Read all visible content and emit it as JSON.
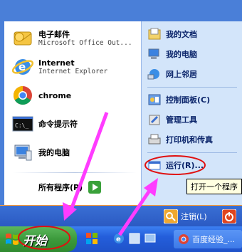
{
  "left_items": [
    {
      "title": "电子邮件",
      "sub": "Microsoft Office Out...",
      "icon": "outlook-mail-icon"
    },
    {
      "title": "Internet",
      "sub": "Internet Explorer",
      "icon": "internet-explorer-icon"
    },
    {
      "title": "chrome",
      "sub": "",
      "icon": "chrome-icon"
    },
    {
      "title": "命令提示符",
      "sub": "",
      "icon": "command-prompt-icon"
    },
    {
      "title": "我的电脑",
      "sub": "",
      "icon": "my-computer-icon"
    }
  ],
  "all_programs": "所有程序(P)",
  "right_items": [
    {
      "label": "我的文档",
      "icon": "my-documents-icon"
    },
    {
      "label": "我的电脑",
      "icon": "my-computer-icon"
    },
    {
      "label": "网上邻居",
      "icon": "network-places-icon"
    },
    {
      "label": "控制面板(C)",
      "icon": "control-panel-icon"
    },
    {
      "label": "管理工具",
      "icon": "admin-tools-icon"
    },
    {
      "label": "打印机和传真",
      "icon": "printers-icon"
    },
    {
      "label": "运行(R)...",
      "icon": "run-icon"
    }
  ],
  "tooltip": "打开一个程序",
  "logoff_label": "注销(L)",
  "start_label": "开始",
  "task_label": "百度经验_...",
  "colors": {
    "highlight_circle": "#e01010",
    "arrow": "#ff3cff"
  }
}
